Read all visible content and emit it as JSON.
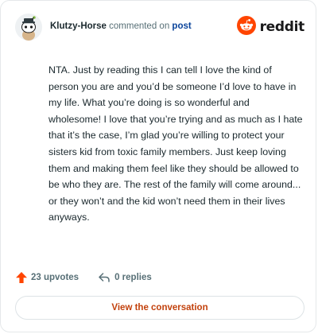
{
  "header": {
    "author": "Klutzy-Horse",
    "action_text": "commented on",
    "post_link": "post",
    "logo_text": "reddit",
    "logo_icon": "reddit-alien-icon",
    "avatar_icon": "snoo-avatar-icon"
  },
  "comment": {
    "body": "NTA. Just by reading this I can tell I love the kind of person you are and you’d be someone I’d love to have in my life. What you’re doing is so wonderful and wholesome! I love that you’re trying and as much as I hate that it’s the case, I’m glad you’re willing to protect your sisters kid from toxic family members. Just keep loving them and making them feel like they should be allowed to be who they are. The rest of the family will come around... or they won’t and the kid won’t need them in their lives anyways."
  },
  "stats": {
    "upvotes": "23 upvotes",
    "upvote_icon": "upvote-arrow-icon",
    "replies": "0 replies",
    "reply_icon": "reply-arrow-icon"
  },
  "cta": {
    "label": "View the conversation"
  },
  "colors": {
    "reddit_orange": "#ff4500",
    "link_blue": "#0a449b",
    "cta_text": "#c2410c",
    "muted_text": "#576f76"
  }
}
